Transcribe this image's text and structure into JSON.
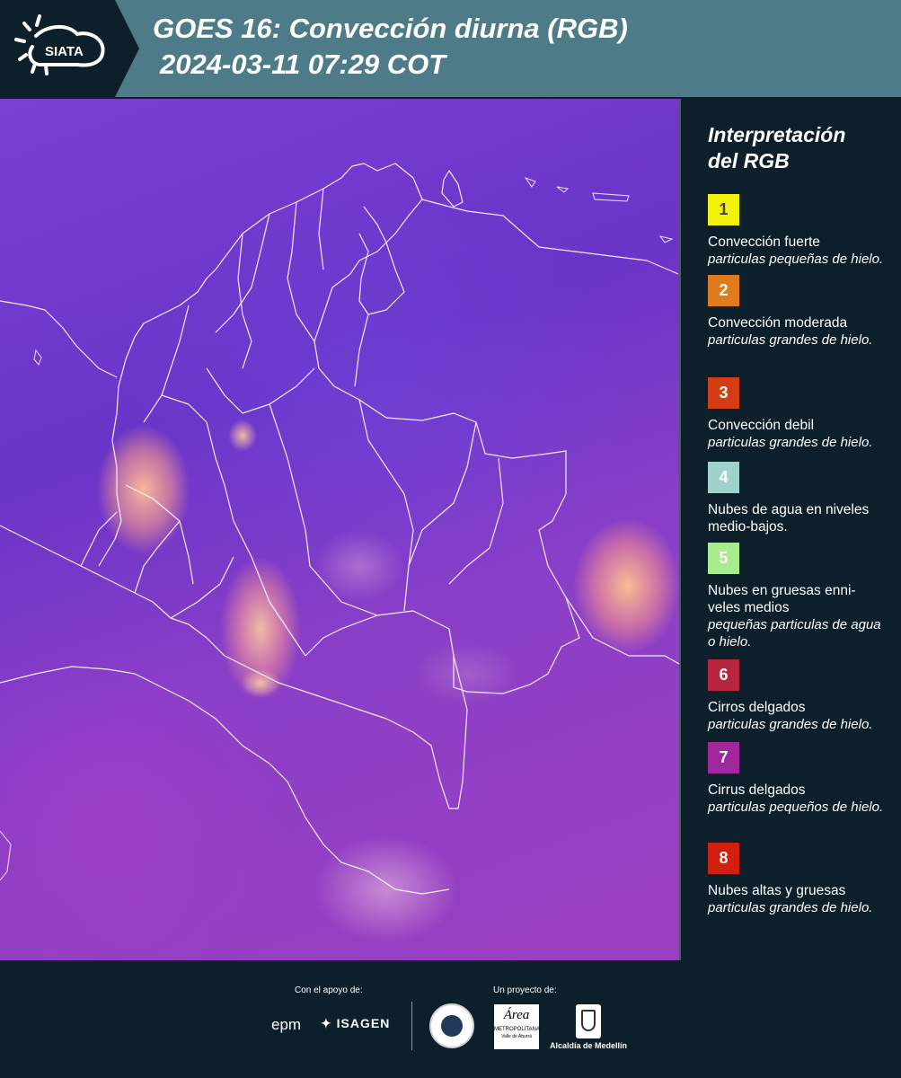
{
  "header": {
    "logo_text": "SIATA",
    "title_line1": "GOES 16: Convección diurna (RGB)",
    "title_line2": "2024-03-11 07:29 COT",
    "background_color": "#4d7b88"
  },
  "map": {
    "description_icon": "satellite-rgb-map",
    "boundary_color": "#ffffff"
  },
  "legend": {
    "title_line1": "Interpretación",
    "title_line2": "del RGB",
    "items": [
      {
        "number": "1",
        "color": "#f4f20a",
        "number_color": "#444444",
        "name": "Convección fuerte",
        "desc": "particulas pequeñas de hielo."
      },
      {
        "number": "2",
        "color": "#e07a1e",
        "number_color": "#ffffff",
        "name": "Convección moderada",
        "desc": "particulas grandes de hielo."
      },
      {
        "number": "3",
        "color": "#d23d14",
        "number_color": "#ffffff",
        "name": "Convección debil",
        "desc": "particulas grandes de hielo."
      },
      {
        "number": "4",
        "color": "#9fd2cc",
        "number_color": "#ffffff",
        "name": "Nubes de agua en niveles medio-bajos.",
        "desc": ""
      },
      {
        "number": "5",
        "color": "#a9ec8f",
        "number_color": "#ffffff",
        "name": "Nubes en gruesas enni- veles medios",
        "desc": "pequeñas particulas de agua o hielo."
      },
      {
        "number": "6",
        "color": "#b8253f",
        "number_color": "#ffffff",
        "name": "Cirros delgados",
        "desc": "particulas grandes de hielo."
      },
      {
        "number": "7",
        "color": "#a0279c",
        "number_color": "#ffffff",
        "name": "Cirrus delgados",
        "desc": "particulas pequeños de hielo."
      },
      {
        "number": "8",
        "color": "#d21f10",
        "number_color": "#ffffff",
        "name": "Nubes altas y gruesas",
        "desc": "particulas grandes de hielo."
      }
    ]
  },
  "footer": {
    "support_label": "Con el apoyo de:",
    "project_label": "Un proyecto de:",
    "sponsor_epm": "epm",
    "sponsor_isagen": "ISAGEN",
    "partner_area_top": "Área",
    "partner_area_name": "METROPOLITANA",
    "partner_area_sub": "Valle de Aburrá",
    "partner_medellin": "Alcaldía de Medellín"
  }
}
